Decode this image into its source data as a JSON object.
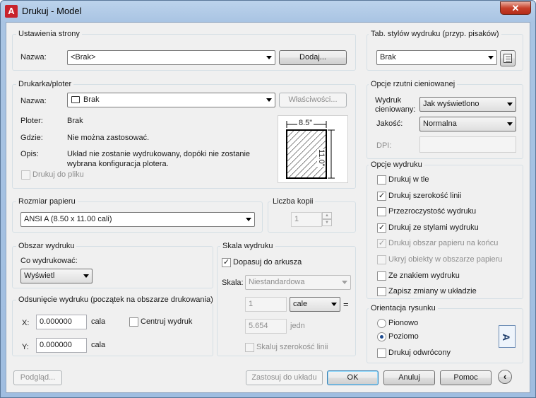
{
  "window": {
    "title": "Drukuj - Model",
    "close_glyph": "✕",
    "app_icon_letter": "A"
  },
  "page_setup": {
    "group_title": "Ustawienia strony",
    "name_label": "Nazwa:",
    "name_value": "<Brak>",
    "add_button": "Dodaj..."
  },
  "printer": {
    "group_title": "Drukarka/ploter",
    "name_label": "Nazwa:",
    "name_value": "Brak",
    "properties_button": "Właściwości...",
    "plotter_label": "Ploter:",
    "plotter_value": "Brak",
    "where_label": "Gdzie:",
    "where_value": "Nie można zastosować.",
    "desc_label": "Opis:",
    "desc_value_line1": "Układ nie zostanie wydrukowany, dopóki nie zostanie",
    "desc_value_line2": "wybrana konfiguracja plotera.",
    "print_to_file": "Drukuj do pliku",
    "preview_width": "8.5\"",
    "preview_height": "11.0\""
  },
  "paper_size": {
    "group_title": "Rozmiar papieru",
    "value": "ANSI A (8.50 x 11.00 cali)"
  },
  "copies": {
    "group_title": "Liczba kopii",
    "value": "1"
  },
  "plot_area": {
    "group_title": "Obszar wydruku",
    "what_label": "Co wydrukować:",
    "what_value": "Wyświetl"
  },
  "plot_offset": {
    "group_title": "Odsunięcie wydruku (początek na obszarze drukowania)",
    "x_label": "X:",
    "x_value": "0.000000",
    "x_unit": "cala",
    "y_label": "Y:",
    "y_value": "0.000000",
    "y_unit": "cala",
    "center_label": "Centruj wydruk"
  },
  "plot_scale": {
    "group_title": "Skala wydruku",
    "fit_label": "Dopasuj do arkusza",
    "scale_label": "Skala:",
    "scale_value": "Niestandardowa",
    "value1": "1",
    "unit1": "cale",
    "equals": "=",
    "value2": "5.654",
    "unit2": "jedn",
    "lineweights_label": "Skaluj szerokość linii"
  },
  "plot_style_table": {
    "group_title": "Tab. stylów wydruku (przyp. pisaków)",
    "value": "Brak"
  },
  "shaded_viewport": {
    "group_title": "Opcje rzutni cieniowanej",
    "shade_label_line1": "Wydruk",
    "shade_label_line2": "cieniowany:",
    "shade_value": "Jak wyświetlono",
    "quality_label": "Jakość:",
    "quality_value": "Normalna",
    "dpi_label": "DPI:"
  },
  "plot_options": {
    "group_title": "Opcje wydruku",
    "items": [
      {
        "label": "Drukuj w tle",
        "checked": false,
        "disabled": false
      },
      {
        "label": "Drukuj szerokość linii",
        "checked": true,
        "disabled": false
      },
      {
        "label": "Przezroczystość wydruku",
        "checked": false,
        "disabled": false
      },
      {
        "label": "Drukuj ze stylami wydruku",
        "checked": true,
        "disabled": false
      },
      {
        "label": "Drukuj obszar papieru na końcu",
        "checked": true,
        "disabled": true
      },
      {
        "label": "Ukryj obiekty w obszarze papieru",
        "checked": false,
        "disabled": true
      },
      {
        "label": "Ze znakiem wydruku",
        "checked": false,
        "disabled": false
      },
      {
        "label": "Zapisz zmiany w układzie",
        "checked": false,
        "disabled": false
      }
    ]
  },
  "orientation": {
    "group_title": "Orientacja rysunku",
    "portrait": "Pionowo",
    "landscape": "Poziomo",
    "upside_down": "Drukuj odwrócony",
    "icon_letter": "A"
  },
  "footer": {
    "preview": "Podgląd...",
    "apply_layout": "Zastosuj do układu",
    "ok": "OK",
    "cancel": "Anuluj",
    "help": "Pomoc",
    "more_glyph": "‹"
  }
}
